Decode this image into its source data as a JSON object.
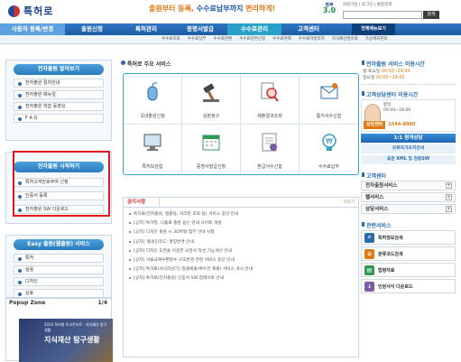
{
  "header": {
    "logo_text": "특허로",
    "slogan_pre": "출원부터 등록, ",
    "slogan_mid": "수수료납부까지",
    "slogan_post": " 편리하게!",
    "gov_badge": "정부",
    "gov_version": "3.0",
    "top_links": "회원가입 | 로그인 | 통합검색",
    "search_value": "",
    "search_button": "검색"
  },
  "nav": {
    "items": [
      "사용자 등록/변경",
      "출원신청",
      "특허관리",
      "증명서발급",
      "수수료관리",
      "고객센터"
    ],
    "dropdown": "전체메뉴보기"
  },
  "subnav": [
    "수수료조회",
    "수수료납부",
    "수수료반환",
    "수수료감면신청",
    "수수료면제",
    "수수료마일리지",
    "지식재산권조회",
    "가상계좌관리"
  ],
  "left": {
    "box1": {
      "title": "전자출원 알아보기",
      "items": [
        "전자출원 절차안내",
        "전자출원 매뉴얼",
        "전자출원 학습 동영상",
        "F A Q"
      ]
    },
    "box2": {
      "title": "전자출원 시작하기",
      "items": [
        "특허고객번호부여 신청",
        "인증서 등록",
        "전자출원 SW 다운로드"
      ]
    },
    "box3": {
      "title": "Easy 출원(웹출원) 서비스",
      "items": [
        "특허",
        "실용",
        "디자인",
        "상표"
      ]
    },
    "popup": {
      "title": "Popup Zone",
      "page": "1/4",
      "banner_small": "2014 특허청 토크콘서트 · 지식재산 탐구생활",
      "banner_big": "지식재산 탐구생활"
    }
  },
  "center": {
    "services_title": "특허로 주요 서비스",
    "services": [
      "국내출원신청",
      "심판청구",
      "제출결과조회",
      "통지서수신함",
      "특허보관함",
      "증명서발급신청",
      "환급서수신함",
      "수수료납부"
    ],
    "notice_tab": "공지사항",
    "notice_more": "더보기",
    "notices": [
      "특허로(전자출원, 법률등, 처리문 조회 등) 서비스 중단 안내",
      "[공지] 특허청, 나홀로 출원 돕는 안내 사이트 개설",
      "[공지] 디자인 출원 시 3D파일 첨부 안내 사항",
      "[공지] '출원인코드' 명칭변경 안내",
      "[공지] 디자인 도면을 이용한 보정서 작성 기능개선 안내",
      "[공지] 서울국제우편접수 구조변경 관련 서비스 중단 안내",
      "[공지] 특허로(서식작성기) 일괄때출(복수건 제출) 서비스 개시 안내",
      "[공지] 특허로(전자출원) 인증서 SW 업데이트 안내"
    ]
  },
  "right": {
    "service_hours_title": "전자출원 서비스 이용시간",
    "hours": [
      {
        "label": "평·토요일",
        "time": "00:00~24:00"
      },
      {
        "label": "일요일",
        "time": "00:00~24:00"
      }
    ],
    "call_title": "고객상담센터 이용시간",
    "call_weekday": "평일",
    "call_time": "09:00~18:00",
    "phone_label": "상담센터",
    "phone_number": "1544-8080",
    "buttons": [
      "1:1 원격상담",
      "오류자가조치안내",
      "표준 XML 및 검증SW"
    ],
    "customer_title": "고객센터",
    "customer_menus": [
      "전자출원서비스",
      "웹서비스",
      "상담서비스"
    ],
    "related_title": "관련서비스",
    "related": [
      "특허정보검색",
      "분류코드검색",
      "법령자료",
      "인원서식 다운로드"
    ]
  }
}
